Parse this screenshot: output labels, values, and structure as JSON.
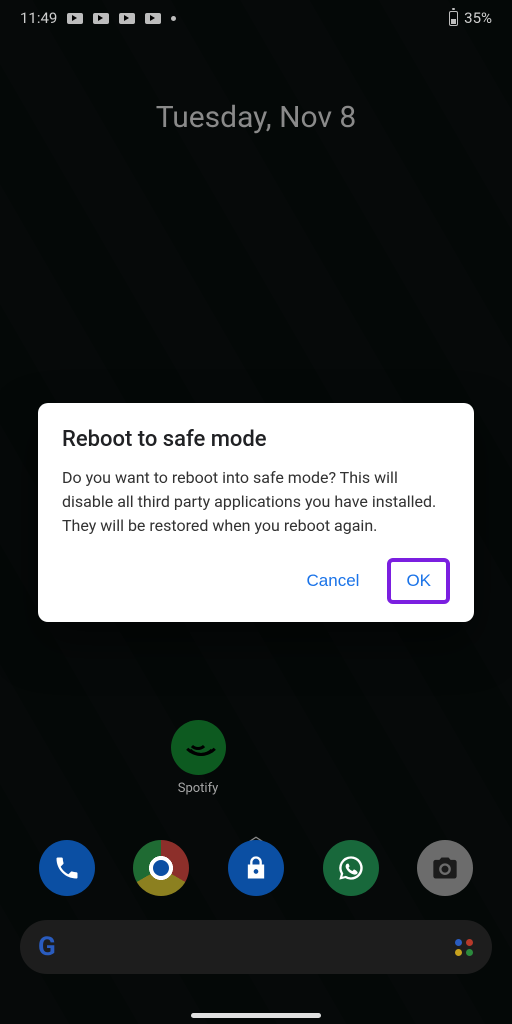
{
  "status_bar": {
    "time": "11:49",
    "battery_percent": "35%"
  },
  "home": {
    "date": "Tuesday, Nov 8",
    "app_label_spotify": "Spotify"
  },
  "dialog": {
    "title": "Reboot to safe mode",
    "body": "Do you want to reboot into safe mode? This will disable all third party applications you have installed. They will be restored when you reboot again.",
    "cancel": "Cancel",
    "ok": "OK"
  },
  "colors": {
    "accent": "#1a73e8",
    "highlight": "#7b1fe0"
  }
}
